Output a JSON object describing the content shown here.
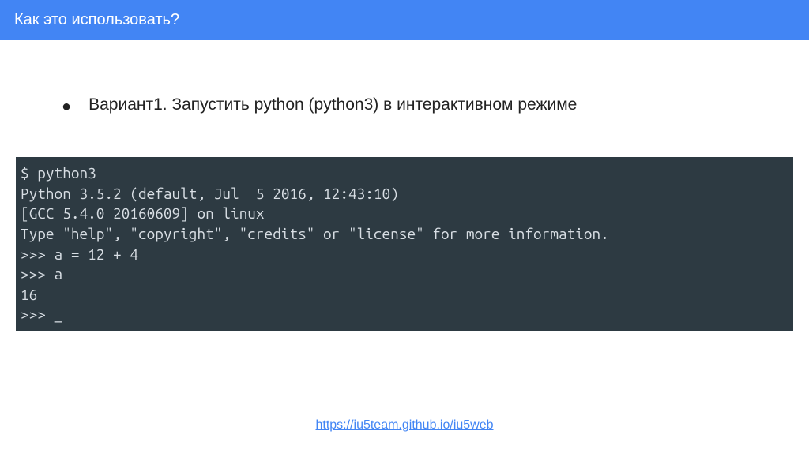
{
  "header": {
    "title": "Как это использовать?"
  },
  "bullet": {
    "text": "Вариант1. Запустить python (python3) в интерактивном режиме"
  },
  "terminal": {
    "lines": "$ python3\nPython 3.5.2 (default, Jul  5 2016, 12:43:10)\n[GCC 5.4.0 20160609] on linux\nType \"help\", \"copyright\", \"credits\" or \"license\" for more information.\n>>> a = 12 + 4\n>>> a\n16\n>>> _"
  },
  "footer": {
    "url": "https://iu5team.github.io/iu5web"
  }
}
